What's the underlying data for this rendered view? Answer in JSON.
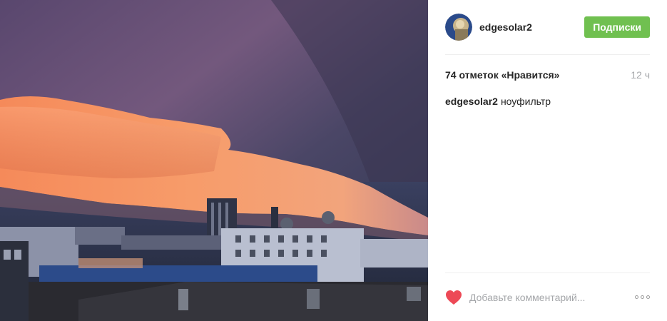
{
  "post": {
    "username": "edgesolar2",
    "follow_label": "Подписки",
    "likes": "74 отметок «Нравится»",
    "time": "12 ч",
    "caption": {
      "username": "edgesolar2",
      "text": "ноуфильтр"
    },
    "comment_placeholder": "Добавьте комментарий...",
    "icons": {
      "like": "heart-icon",
      "more": "more-options-icon"
    },
    "colors": {
      "follow_button": "#70c050",
      "heart": "#ed4956",
      "muted_text": "#a5a7aa"
    }
  }
}
